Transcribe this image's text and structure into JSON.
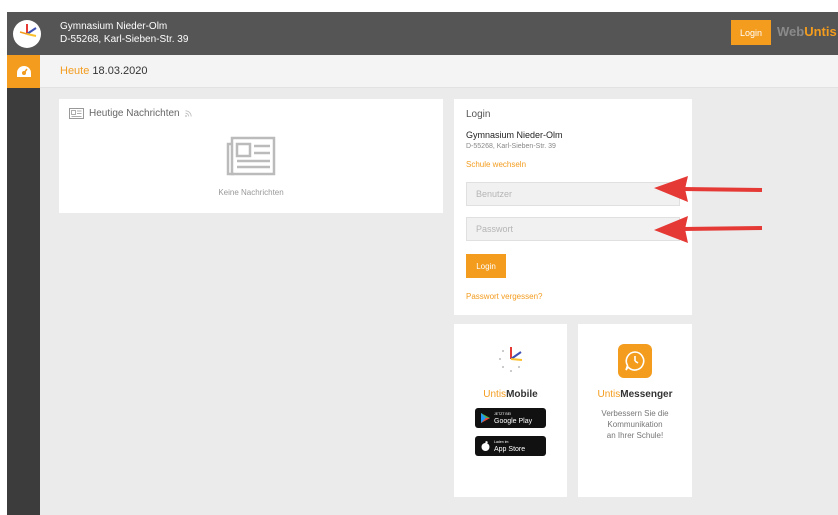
{
  "header": {
    "school_name": "Gymnasium Nieder-Olm",
    "school_address": "D-55268, Karl-Sieben-Str. 39",
    "login_label": "Login",
    "brand_part1": "Web",
    "brand_part2": "Untis"
  },
  "subbar": {
    "today_label": "Heute",
    "date": "18.03.2020"
  },
  "news": {
    "title": "Heutige Nachrichten",
    "empty_text": "Keine Nachrichten"
  },
  "login": {
    "title": "Login",
    "school_name": "Gymnasium Nieder-Olm",
    "school_address": "D-55268, Karl-Sieben-Str. 39",
    "switch_school": "Schule wechseln",
    "username_placeholder": "Benutzer",
    "password_placeholder": "Passwort",
    "login_button": "Login",
    "forgot_password": "Passwort vergessen?"
  },
  "mobile": {
    "title_part1": "Untis",
    "title_part2": "Mobile",
    "google_small": "JETZT BEI",
    "google_big": "Google Play",
    "apple_small": "Laden im",
    "apple_big": "App Store"
  },
  "messenger": {
    "title_part1": "Untis",
    "title_part2": "Messenger",
    "description_line1": "Verbessern Sie die",
    "description_line2": "Kommunikation",
    "description_line3": "an Ihrer Schule!"
  },
  "colors": {
    "accent": "#f39c1e",
    "topbar": "#555555",
    "sidebar": "#3c3c3c",
    "content_bg": "#ebebeb",
    "arrow": "#e53935"
  }
}
